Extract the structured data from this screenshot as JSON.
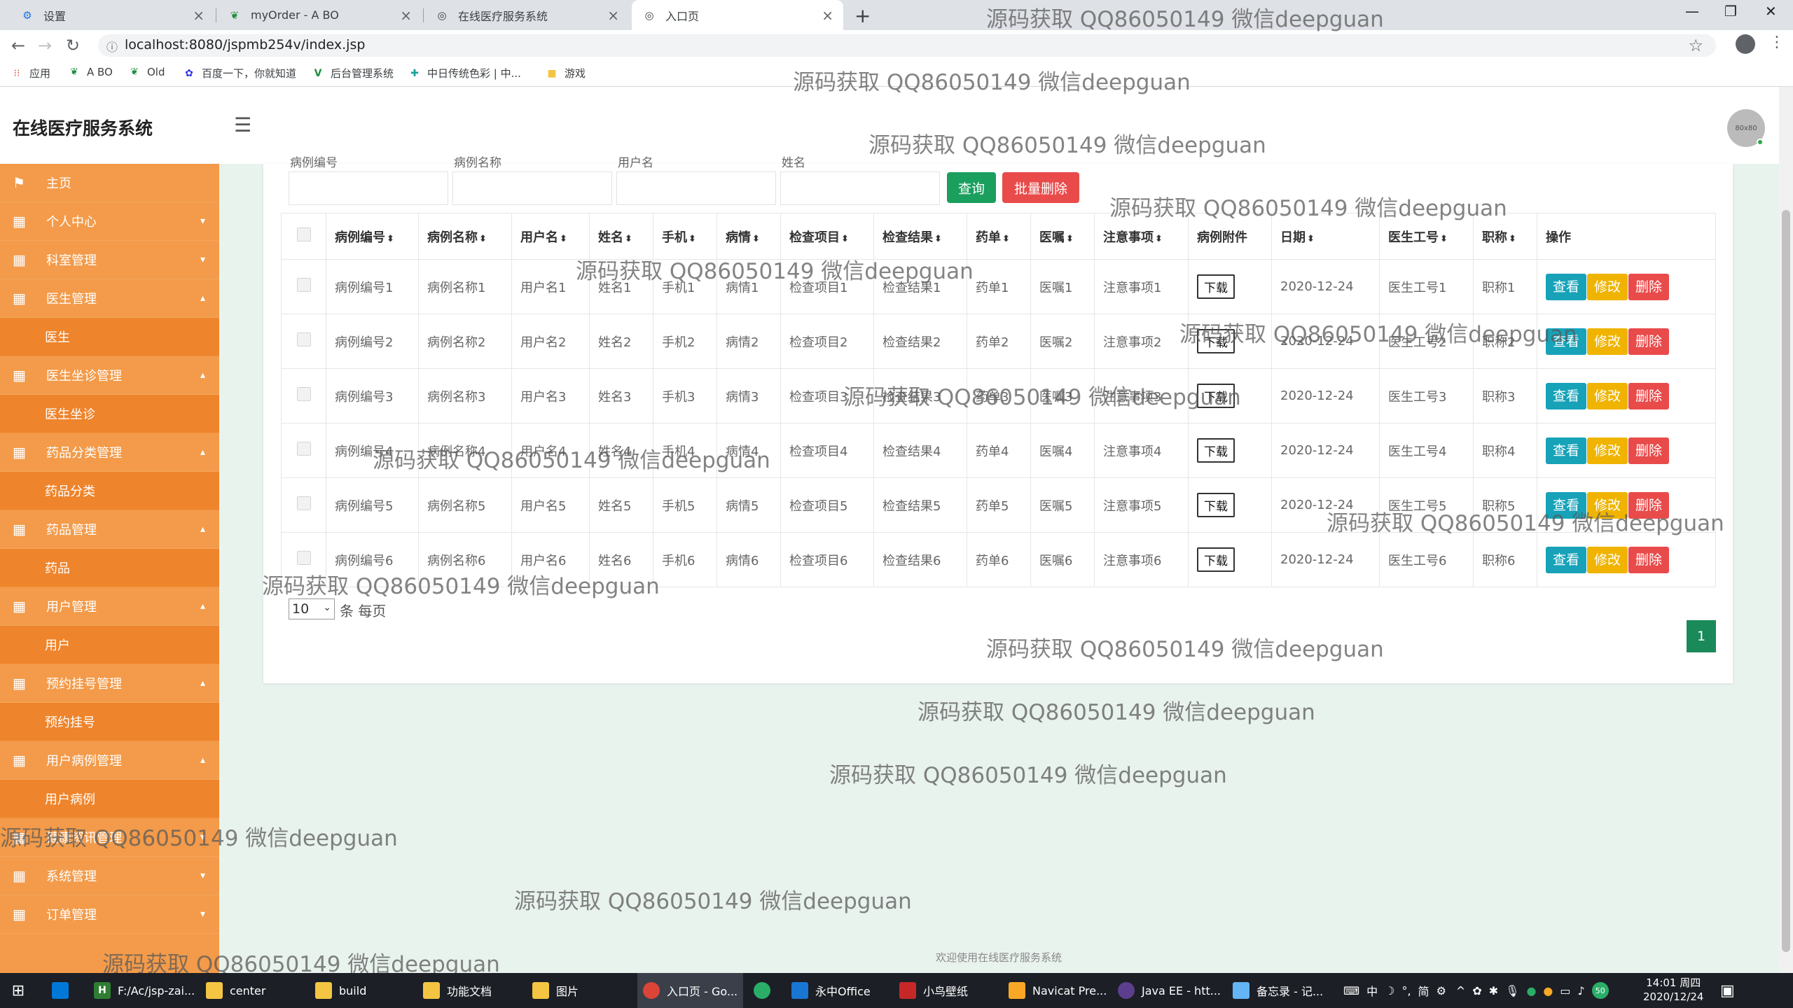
{
  "browser": {
    "tabs": [
      {
        "title": "设置",
        "icon": "gear-icon"
      },
      {
        "title": "myOrder - A BO",
        "icon": "leaf-icon"
      },
      {
        "title": "在线医疗服务系统",
        "icon": "globe-icon"
      },
      {
        "title": "入口页",
        "icon": "globe-icon"
      }
    ],
    "new_tab_label": "+",
    "url": "localhost:8080/jspmb254v/index.jsp",
    "bookmarks": [
      {
        "label": "应用",
        "icon": "apps-icon"
      },
      {
        "label": "A BO",
        "icon": "leaf-icon"
      },
      {
        "label": "Old",
        "icon": "leaf-icon"
      },
      {
        "label": "百度一下，你就知道",
        "icon": "paw-icon"
      },
      {
        "label": "后台管理系统",
        "icon": "v-icon"
      },
      {
        "label": "中日传统色彩 | 中...",
        "icon": "puzzle-icon"
      },
      {
        "label": "游戏",
        "icon": "folder-icon"
      }
    ]
  },
  "app": {
    "title": "在线医疗服务系统",
    "avatar_text": "80x80",
    "footer": "欢迎使用在线医疗服务系统"
  },
  "sidebar": {
    "items": [
      {
        "label": "主页",
        "icon": "flag-icon",
        "sub": false,
        "arrow": ""
      },
      {
        "label": "个人中心",
        "icon": "grid-icon",
        "sub": false,
        "arrow": "▾"
      },
      {
        "label": "科室管理",
        "icon": "grid-icon",
        "sub": false,
        "arrow": "▾"
      },
      {
        "label": "医生管理",
        "icon": "grid-icon",
        "sub": false,
        "arrow": "▴"
      },
      {
        "label": "医生",
        "icon": "",
        "sub": true,
        "arrow": ""
      },
      {
        "label": "医生坐诊管理",
        "icon": "grid-icon",
        "sub": false,
        "arrow": "▴"
      },
      {
        "label": "医生坐诊",
        "icon": "",
        "sub": true,
        "arrow": ""
      },
      {
        "label": "药品分类管理",
        "icon": "grid-icon",
        "sub": false,
        "arrow": "▴"
      },
      {
        "label": "药品分类",
        "icon": "",
        "sub": true,
        "arrow": ""
      },
      {
        "label": "药品管理",
        "icon": "grid-icon",
        "sub": false,
        "arrow": "▴"
      },
      {
        "label": "药品",
        "icon": "",
        "sub": true,
        "arrow": ""
      },
      {
        "label": "用户管理",
        "icon": "grid-icon",
        "sub": false,
        "arrow": "▴"
      },
      {
        "label": "用户",
        "icon": "",
        "sub": true,
        "arrow": ""
      },
      {
        "label": "预约挂号管理",
        "icon": "grid-icon",
        "sub": false,
        "arrow": "▴"
      },
      {
        "label": "预约挂号",
        "icon": "",
        "sub": true,
        "arrow": ""
      },
      {
        "label": "用户病例管理",
        "icon": "grid-icon",
        "sub": false,
        "arrow": "▴"
      },
      {
        "label": "用户病例",
        "icon": "",
        "sub": true,
        "arrow": ""
      },
      {
        "label": "健康资讯管理",
        "icon": "grid-icon",
        "sub": false,
        "arrow": "▾"
      },
      {
        "label": "系统管理",
        "icon": "grid-icon",
        "sub": false,
        "arrow": "▾"
      },
      {
        "label": "订单管理",
        "icon": "grid-icon",
        "sub": false,
        "arrow": "▾"
      }
    ]
  },
  "search": {
    "labels": [
      "病例编号",
      "病例名称",
      "用户名",
      "姓名"
    ],
    "query_button": "查询",
    "batch_delete_button": "批量删除"
  },
  "table": {
    "headers": [
      "病例编号",
      "病例名称",
      "用户名",
      "姓名",
      "手机",
      "病情",
      "检查项目",
      "检查结果",
      "药单",
      "医嘱",
      "注意事项",
      "病例附件",
      "日期",
      "医生工号",
      "职称",
      "操作"
    ],
    "sortable": [
      true,
      true,
      true,
      true,
      true,
      true,
      true,
      true,
      true,
      true,
      true,
      false,
      true,
      true,
      true,
      false
    ],
    "download_label": "下载",
    "actions": {
      "view": "查看",
      "edit": "修改",
      "delete": "删除"
    },
    "rows": [
      [
        "病例编号1",
        "病例名称1",
        "用户名1",
        "姓名1",
        "手机1",
        "病情1",
        "检查项目1",
        "检查结果1",
        "药单1",
        "医嘱1",
        "注意事项1",
        "",
        "2020-12-24",
        "医生工号1",
        "职称1"
      ],
      [
        "病例编号2",
        "病例名称2",
        "用户名2",
        "姓名2",
        "手机2",
        "病情2",
        "检查项目2",
        "检查结果2",
        "药单2",
        "医嘱2",
        "注意事项2",
        "",
        "2020-12-24",
        "医生工号2",
        "职称2"
      ],
      [
        "病例编号3",
        "病例名称3",
        "用户名3",
        "姓名3",
        "手机3",
        "病情3",
        "检查项目3",
        "检查结果3",
        "药单3",
        "医嘱3",
        "注意事项3",
        "",
        "2020-12-24",
        "医生工号3",
        "职称3"
      ],
      [
        "病例编号4",
        "病例名称4",
        "用户名4",
        "姓名4",
        "手机4",
        "病情4",
        "检查项目4",
        "检查结果4",
        "药单4",
        "医嘱4",
        "注意事项4",
        "",
        "2020-12-24",
        "医生工号4",
        "职称4"
      ],
      [
        "病例编号5",
        "病例名称5",
        "用户名5",
        "姓名5",
        "手机5",
        "病情5",
        "检查项目5",
        "检查结果5",
        "药单5",
        "医嘱5",
        "注意事项5",
        "",
        "2020-12-24",
        "医生工号5",
        "职称5"
      ],
      [
        "病例编号6",
        "病例名称6",
        "用户名6",
        "姓名6",
        "手机6",
        "病情6",
        "检查项目6",
        "检查结果6",
        "药单6",
        "医嘱6",
        "注意事项6",
        "",
        "2020-12-24",
        "医生工号6",
        "职称6"
      ]
    ]
  },
  "pagination": {
    "page_size": "10",
    "per_page_label": "条 每页",
    "current_page": "1"
  },
  "watermark": "源码获取 QQ86050149 微信deepguan",
  "taskbar": {
    "items": [
      {
        "label": "",
        "icon": "store-icon"
      },
      {
        "label": "F:/Ac/jsp-zai...",
        "icon": "h-icon"
      },
      {
        "label": "center",
        "icon": "folder-icon"
      },
      {
        "label": "build",
        "icon": "folder-icon"
      },
      {
        "label": "功能文档",
        "icon": "folder-icon"
      },
      {
        "label": "图片",
        "icon": "folder-icon"
      },
      {
        "label": "入口页 - Go...",
        "icon": "chrome-icon"
      },
      {
        "label": "",
        "icon": "wechat-icon"
      },
      {
        "label": "永中Office",
        "icon": "office-icon"
      },
      {
        "label": "小鸟壁纸",
        "icon": "bird-icon"
      },
      {
        "label": "Navicat Pre...",
        "icon": "navicat-icon"
      },
      {
        "label": "Java EE - htt...",
        "icon": "eclipse-icon"
      },
      {
        "label": "备忘录 - 记...",
        "icon": "notepad-icon"
      }
    ],
    "ime": "中",
    "ime_mode": "简",
    "battery": "50",
    "time": "14:01 周四",
    "date": "2020/12/24"
  },
  "colors": {
    "sidebar": "#f39b4a",
    "sidebar_sub": "#ee842b",
    "content_bg": "#e9f3ee",
    "query": "#1a9f5f",
    "danger": "#e94b4b",
    "info": "#17a2b8",
    "warning": "#f0b400",
    "page_active": "#1a8a5a"
  }
}
